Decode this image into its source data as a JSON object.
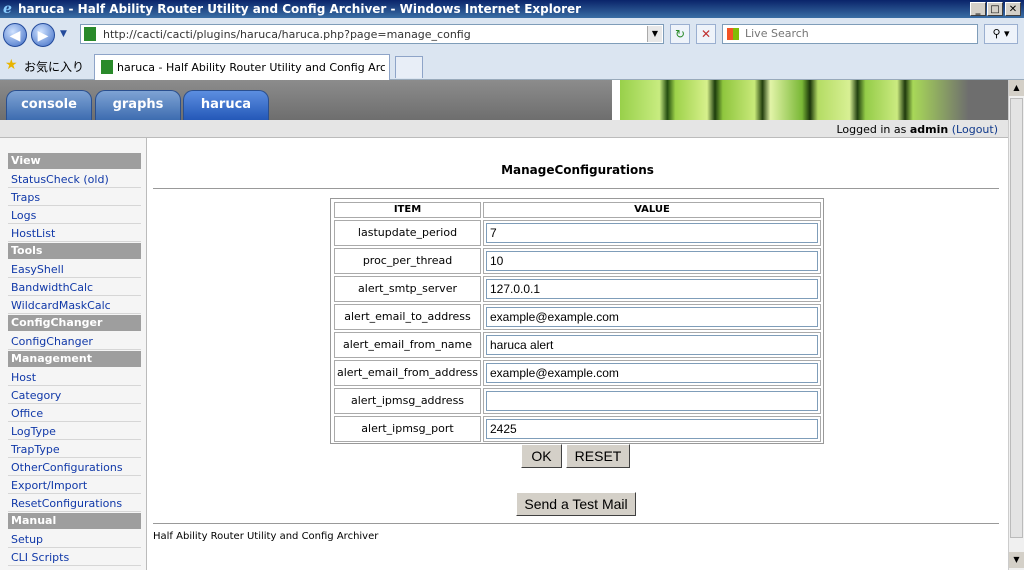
{
  "window": {
    "title": "haruca - Half Ability Router Utility and Config Archiver - Windows Internet Explorer",
    "controls": [
      "_",
      "□",
      "✕"
    ]
  },
  "browser": {
    "url": "http://cacti/cacti/plugins/haruca/haruca.php?page=manage_config",
    "search_placeholder": "Live Search",
    "favorites_label": "お気に入り",
    "tab_title": "haruca - Half Ability Router Utility and Config Arc..."
  },
  "header": {
    "tabs": [
      "console",
      "graphs",
      "haruca"
    ],
    "active_tab": "haruca",
    "login_prefix": "Logged in as",
    "user": "admin",
    "logout": "(Logout)"
  },
  "sidebar": {
    "sections": [
      {
        "title": "View",
        "items": [
          "StatusCheck (old)",
          "Traps",
          "Logs",
          "HostList"
        ]
      },
      {
        "title": "Tools",
        "items": [
          "EasyShell",
          "BandwidthCalc",
          "WildcardMaskCalc"
        ]
      },
      {
        "title": "ConfigChanger",
        "items": [
          "ConfigChanger"
        ]
      },
      {
        "title": "Management",
        "items": [
          "Host",
          "Category",
          "Office",
          "LogType",
          "TrapType",
          "OtherConfigurations",
          "Export/Import",
          "ResetConfigurations"
        ]
      },
      {
        "title": "Manual",
        "items": [
          "Setup",
          "CLI Scripts"
        ]
      }
    ]
  },
  "main": {
    "title": "ManageConfigurations",
    "columns": [
      "ITEM",
      "VALUE"
    ],
    "rows": [
      {
        "item": "lastupdate_period",
        "value": "7"
      },
      {
        "item": "proc_per_thread",
        "value": "10"
      },
      {
        "item": "alert_smtp_server",
        "value": "127.0.0.1"
      },
      {
        "item": "alert_email_to_address",
        "value": "example@example.com"
      },
      {
        "item": "alert_email_from_name",
        "value": "haruca alert"
      },
      {
        "item": "alert_email_from_address",
        "value": "example@example.com"
      },
      {
        "item": "alert_ipmsg_address",
        "value": ""
      },
      {
        "item": "alert_ipmsg_port",
        "value": "2425"
      }
    ],
    "ok_label": "OK",
    "reset_label": "RESET",
    "test_mail_label": "Send a Test Mail",
    "footer": "Half Ability Router Utility and Config Archiver"
  }
}
